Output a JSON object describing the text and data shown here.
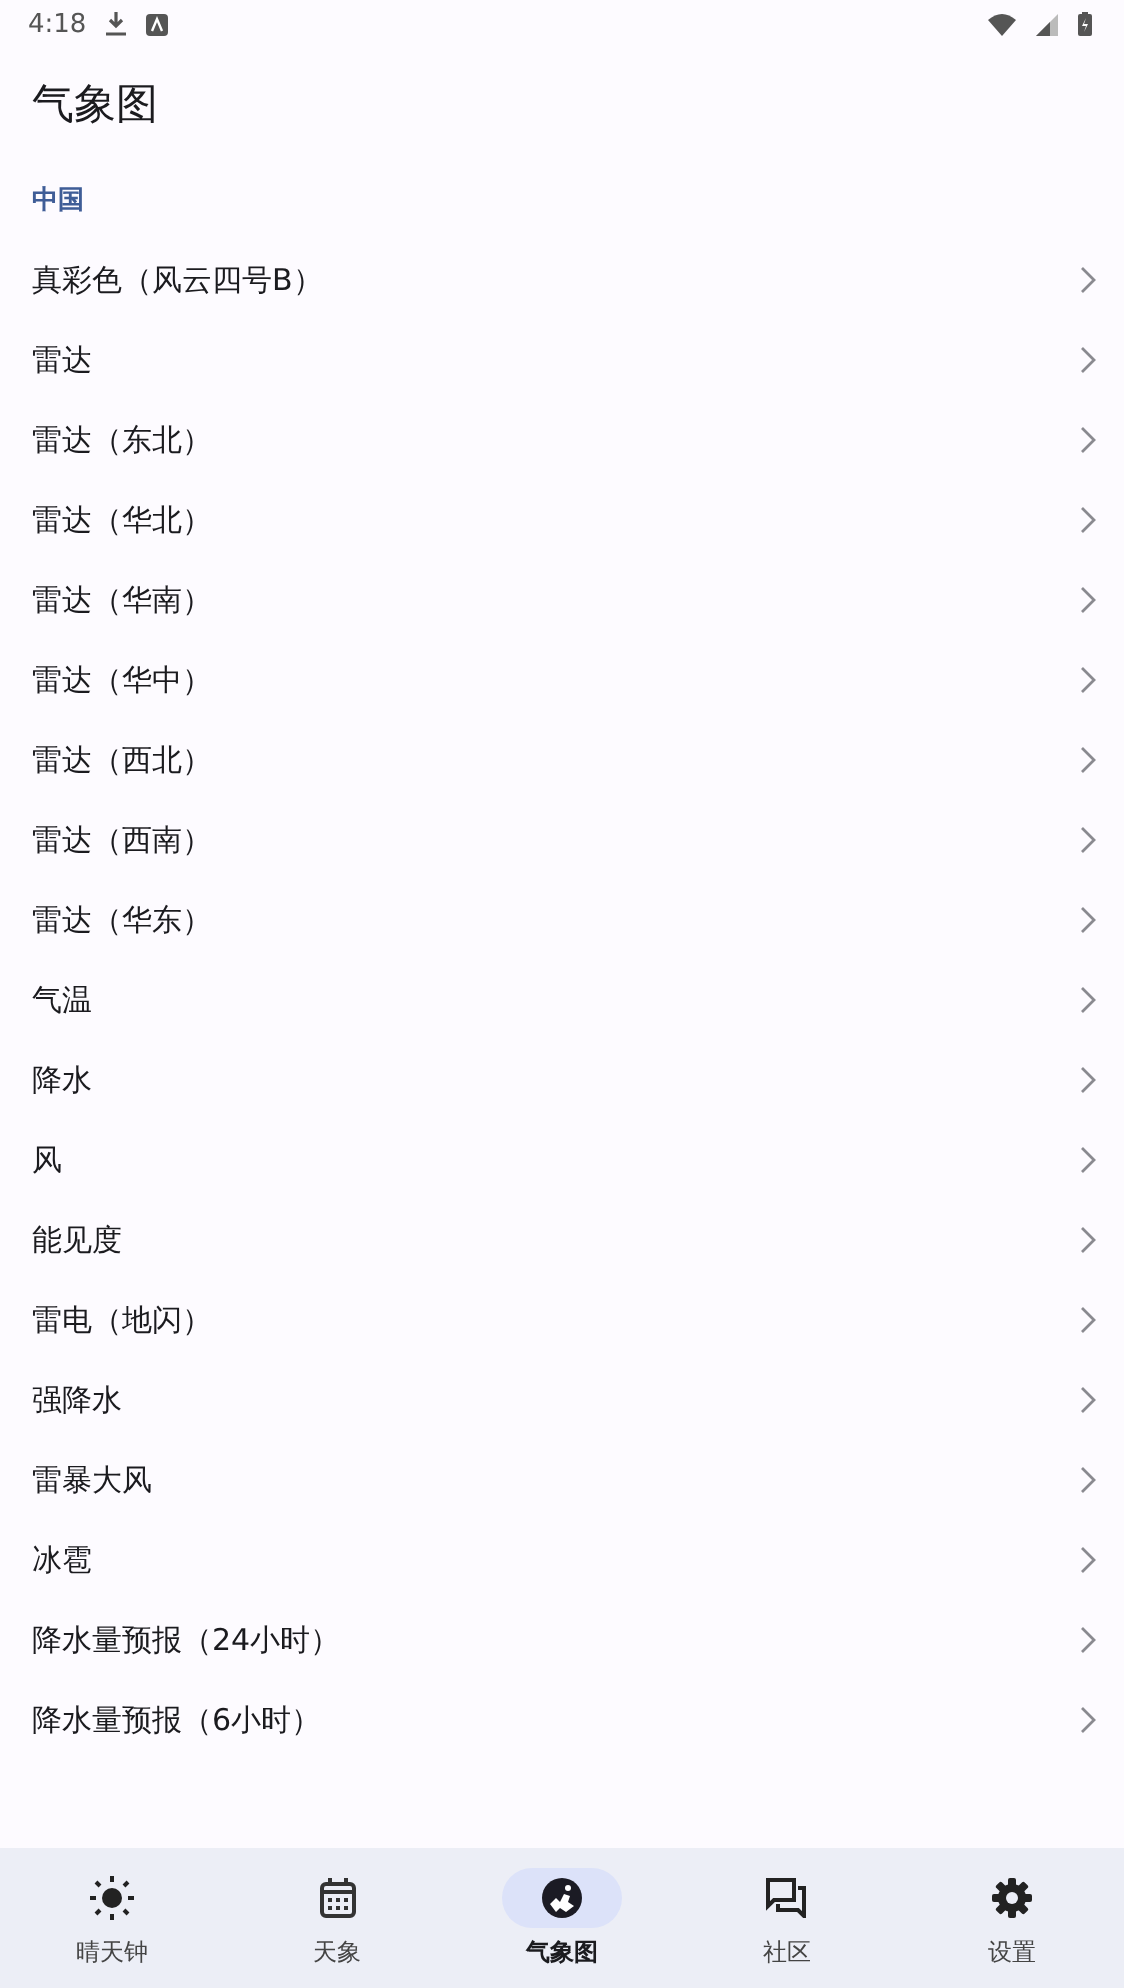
{
  "status_bar": {
    "time": "4:18"
  },
  "title": "气象图",
  "section": {
    "header": "中国",
    "items": [
      {
        "label": "真彩色（风云四号B）"
      },
      {
        "label": "雷达"
      },
      {
        "label": "雷达（东北）"
      },
      {
        "label": "雷达（华北）"
      },
      {
        "label": "雷达（华南）"
      },
      {
        "label": "雷达（华中）"
      },
      {
        "label": "雷达（西北）"
      },
      {
        "label": "雷达（西南）"
      },
      {
        "label": "雷达（华东）"
      },
      {
        "label": "气温"
      },
      {
        "label": "降水"
      },
      {
        "label": "风"
      },
      {
        "label": "能见度"
      },
      {
        "label": "雷电（地闪）"
      },
      {
        "label": "强降水"
      },
      {
        "label": "雷暴大风"
      },
      {
        "label": "冰雹"
      },
      {
        "label": "降水量预报（24小时）"
      },
      {
        "label": "降水量预报（6小时）"
      }
    ]
  },
  "nav": [
    {
      "label": "晴天钟",
      "kind": "sun",
      "selected": false
    },
    {
      "label": "天象",
      "kind": "calendar",
      "selected": false
    },
    {
      "label": "气象图",
      "kind": "globe",
      "selected": true
    },
    {
      "label": "社区",
      "kind": "chat",
      "selected": false
    },
    {
      "label": "设置",
      "kind": "gear",
      "selected": false
    }
  ]
}
